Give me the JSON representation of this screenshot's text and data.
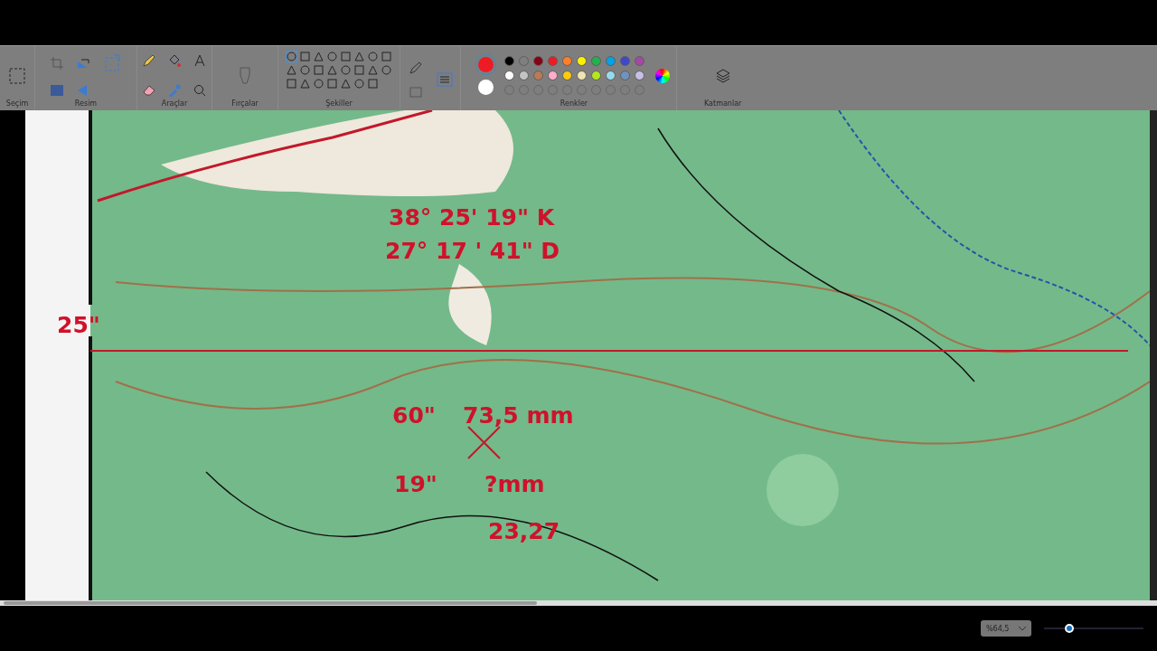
{
  "toolbar": {
    "groups": [
      {
        "label": "Seçim"
      },
      {
        "label": "Resim"
      },
      {
        "label": "Araçlar"
      },
      {
        "label": "Fırçalar"
      },
      {
        "label": "Şekiller"
      },
      {
        "label": "Renkler"
      },
      {
        "label": "Katmanlar"
      }
    ]
  },
  "colors": {
    "current": [
      {
        "color": "#ed1c24"
      },
      {
        "color": "#ffffff"
      }
    ],
    "swatches": [
      {
        "kind": "swatch",
        "color": "#000000"
      },
      {
        "kind": "swatch",
        "color": "#7f7f7f"
      },
      {
        "kind": "swatch",
        "color": "#880015"
      },
      {
        "kind": "swatch",
        "color": "#ed1c24"
      },
      {
        "kind": "swatch",
        "color": "#ff7f27"
      },
      {
        "kind": "swatch",
        "color": "#fff200"
      },
      {
        "kind": "swatch",
        "color": "#22b14c"
      },
      {
        "kind": "swatch",
        "color": "#00a2e8"
      },
      {
        "kind": "swatch",
        "color": "#3f48cc"
      },
      {
        "kind": "swatch",
        "color": "#a349a4"
      },
      {
        "kind": "swatch",
        "color": "#ffffff"
      },
      {
        "kind": "swatch",
        "color": "#c3c3c3"
      },
      {
        "kind": "swatch",
        "color": "#b97a57"
      },
      {
        "kind": "swatch",
        "color": "#ffaec9"
      },
      {
        "kind": "swatch",
        "color": "#ffc90e"
      },
      {
        "kind": "swatch",
        "color": "#efe4b0"
      },
      {
        "kind": "swatch",
        "color": "#b5e61d"
      },
      {
        "kind": "swatch",
        "color": "#99d9ea"
      },
      {
        "kind": "swatch",
        "color": "#7092be"
      },
      {
        "kind": "swatch",
        "color": "#c8bfe7"
      },
      {
        "kind": "empty"
      },
      {
        "kind": "empty"
      },
      {
        "kind": "empty"
      },
      {
        "kind": "empty"
      },
      {
        "kind": "empty"
      },
      {
        "kind": "empty"
      },
      {
        "kind": "empty"
      },
      {
        "kind": "empty"
      },
      {
        "kind": "empty"
      },
      {
        "kind": "empty"
      }
    ]
  },
  "canvas": {
    "kind": "picture",
    "annotations": [
      {
        "text": "38° 25' 19\" K"
      },
      {
        "text": "27° 17 ' 41\" D"
      },
      {
        "text": "25\""
      },
      {
        "text": "60\""
      },
      {
        "text": "73,5 mm"
      },
      {
        "text": "19\""
      },
      {
        "text": "?mm"
      },
      {
        "text": "23,27"
      }
    ]
  },
  "status_bar": {
    "zoom": "%64,5",
    "zoom_slider": {
      "level": 0.25
    }
  }
}
